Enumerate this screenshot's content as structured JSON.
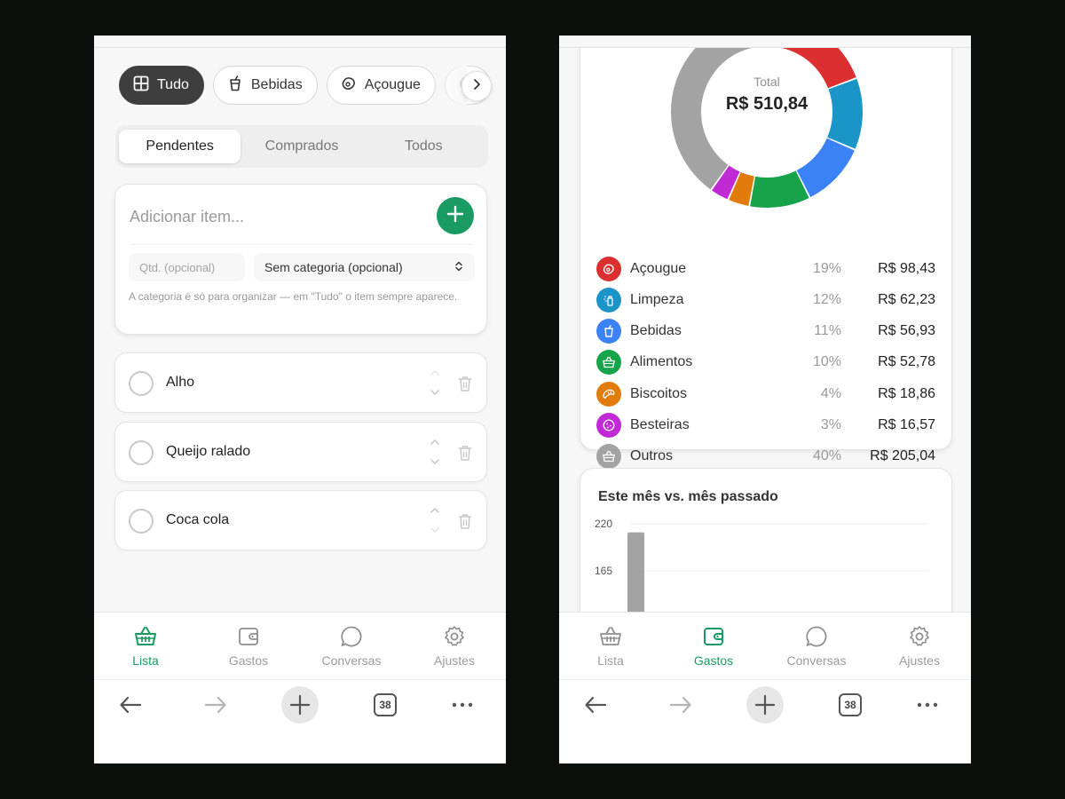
{
  "left": {
    "chips": [
      {
        "label": "Tudo",
        "icon": "grid-icon",
        "active": true
      },
      {
        "label": "Bebidas",
        "icon": "cup-icon",
        "active": false
      },
      {
        "label": "Açougue",
        "icon": "meat-icon",
        "active": false
      }
    ],
    "tabs": [
      {
        "label": "Pendentes",
        "active": true
      },
      {
        "label": "Comprados",
        "active": false
      },
      {
        "label": "Todos",
        "active": false
      }
    ],
    "add_form": {
      "placeholder": "Adicionar item...",
      "qty_placeholder": "Qtd. (opcional)",
      "category_value": "Sem categoria (opcional)",
      "hint": "A categoria é só para organizar — em \"Tudo\" o item sempre aparece."
    },
    "items": [
      {
        "name": "Alho"
      },
      {
        "name": "Queijo ralado"
      },
      {
        "name": "Coca cola"
      }
    ],
    "nav": [
      {
        "label": "Lista",
        "icon": "basket-icon",
        "active": true
      },
      {
        "label": "Gastos",
        "icon": "wallet-icon",
        "active": false
      },
      {
        "label": "Conversas",
        "icon": "chat-icon",
        "active": false
      },
      {
        "label": "Ajustes",
        "icon": "gear-icon",
        "active": false
      }
    ]
  },
  "right": {
    "total_label": "Total",
    "total_value": "R$ 510,84",
    "categories": [
      {
        "name": "Açougue",
        "pct": "19%",
        "value": "R$ 98,43",
        "color": "#dc2f2f",
        "icon": "meat-icon"
      },
      {
        "name": "Limpeza",
        "pct": "12%",
        "value": "R$ 62,23",
        "color": "#1b94c7",
        "icon": "spray-icon"
      },
      {
        "name": "Bebidas",
        "pct": "11%",
        "value": "R$ 56,93",
        "color": "#3b82f6",
        "icon": "cup-icon"
      },
      {
        "name": "Alimentos",
        "pct": "10%",
        "value": "R$ 52,78",
        "color": "#17a34a",
        "icon": "basket-icon"
      },
      {
        "name": "Biscoitos",
        "pct": "4%",
        "value": "R$ 18,86",
        "color": "#e07b0c",
        "icon": "croissant-icon"
      },
      {
        "name": "Besteiras",
        "pct": "3%",
        "value": "R$ 16,57",
        "color": "#c02ad4",
        "icon": "cookie-icon"
      },
      {
        "name": "Outros",
        "pct": "40%",
        "value": "R$ 205,04",
        "color": "#a3a3a3",
        "icon": "basket-icon"
      }
    ],
    "comparison_title": "Este mês vs. mês passado",
    "nav": [
      {
        "label": "Lista",
        "icon": "basket-icon",
        "active": false
      },
      {
        "label": "Gastos",
        "icon": "wallet-icon",
        "active": true
      },
      {
        "label": "Conversas",
        "icon": "chat-icon",
        "active": false
      },
      {
        "label": "Ajustes",
        "icon": "gear-icon",
        "active": false
      }
    ]
  },
  "browser": {
    "tab_count": "38"
  },
  "colors": {
    "accent": "#1a9b63",
    "chip_active": "#3e3e3e"
  },
  "chart_data": [
    {
      "type": "pie",
      "series": [
        {
          "values": [
            98.43,
            62.23,
            56.93,
            52.78,
            18.86,
            16.57,
            205.04
          ]
        }
      ],
      "categories": [
        "Açougue",
        "Limpeza",
        "Bebidas",
        "Alimentos",
        "Biscoitos",
        "Besteiras",
        "Outros"
      ],
      "colors": [
        "#dc2f2f",
        "#1b94c7",
        "#3b82f6",
        "#17a34a",
        "#e07b0c",
        "#c02ad4",
        "#a3a3a3"
      ],
      "title": "",
      "legend": "below"
    },
    {
      "type": "bar",
      "title": "Este mês vs. mês passado",
      "yticks": [
        "220",
        "165"
      ],
      "ylim": [
        110,
        220
      ],
      "values": [
        210
      ],
      "colors": [
        "#a3a3a3"
      ],
      "grid": true
    }
  ]
}
